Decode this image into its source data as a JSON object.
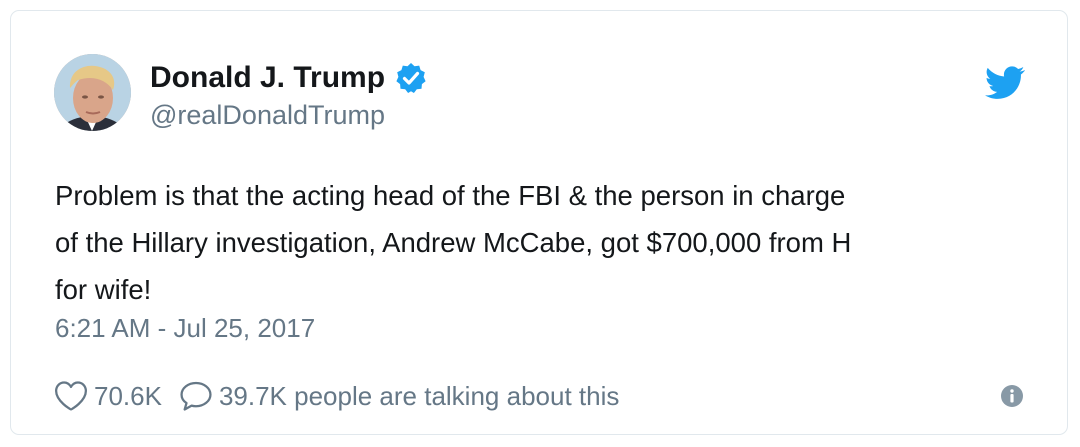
{
  "author": {
    "display_name": "Donald J. Trump",
    "handle": "@realDonaldTrump",
    "verified": true
  },
  "tweet": {
    "text": "Problem is that the acting head of the FBI & the person in charge\nof the Hillary investigation, Andrew McCabe, got $700,000 from H\nfor wife!",
    "timestamp": "6:21 AM - Jul 25, 2017"
  },
  "stats": {
    "likes": "70.6K",
    "replies_text": "39.7K people are talking about this"
  },
  "icons": {
    "brand": "twitter-bird-icon",
    "verified": "verified-badge-icon",
    "like": "heart-icon",
    "reply": "speech-bubble-icon",
    "info": "info-icon"
  },
  "colors": {
    "brand_blue": "#1da1f2",
    "text_primary": "#14171a",
    "text_secondary": "#657786",
    "border": "#e1e8ed"
  }
}
